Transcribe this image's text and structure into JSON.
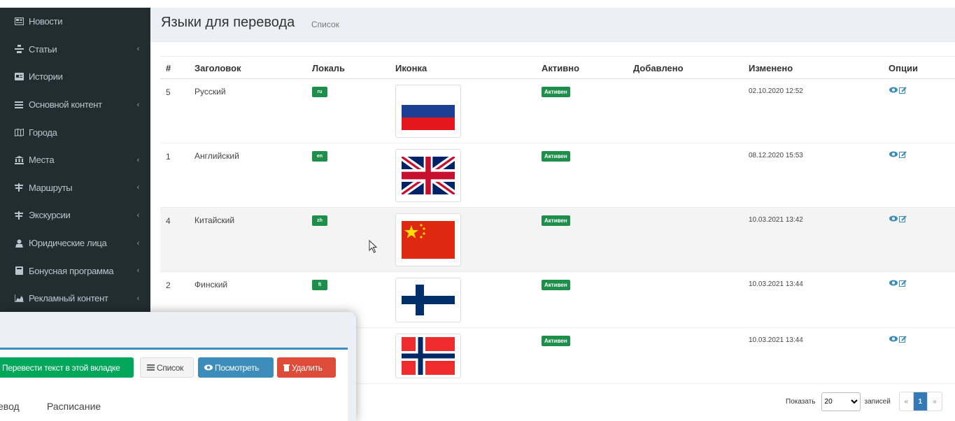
{
  "sidebar": {
    "items": [
      {
        "label": "Новости",
        "icon": "newspaper-icon",
        "has_chevron": false
      },
      {
        "label": "Статьи",
        "icon": "articles-icon",
        "has_chevron": true
      },
      {
        "label": "Истории",
        "icon": "id-card-icon",
        "has_chevron": false
      },
      {
        "label": "Основной контент",
        "icon": "bars-icon",
        "has_chevron": true
      },
      {
        "label": "Города",
        "icon": "map-icon",
        "has_chevron": false
      },
      {
        "label": "Места",
        "icon": "bank-icon",
        "has_chevron": true
      },
      {
        "label": "Маршруты",
        "icon": "signpost-icon",
        "has_chevron": true
      },
      {
        "label": "Экскурсии",
        "icon": "signpost-icon",
        "has_chevron": true
      },
      {
        "label": "Юридические лица",
        "icon": "user-secret-icon",
        "has_chevron": true
      },
      {
        "label": "Бонусная программа",
        "icon": "calculator-icon",
        "has_chevron": true
      },
      {
        "label": "Рекламный контент",
        "icon": "area-chart-icon",
        "has_chevron": true
      }
    ],
    "chevron": "‹"
  },
  "header": {
    "title": "Языки для перевода",
    "subtitle": "Список"
  },
  "table": {
    "columns": [
      "#",
      "Заголовок",
      "Локаль",
      "Иконка",
      "Активно",
      "Добавлено",
      "Изменено",
      "Опции"
    ],
    "rows": [
      {
        "id": "5",
        "title": "Русский",
        "locale": "ru",
        "flag": "russia-flag",
        "active": "Активен",
        "added": "",
        "modified": "02.10.2020 12:52"
      },
      {
        "id": "1",
        "title": "Английский",
        "locale": "en",
        "flag": "uk-flag",
        "active": "Активен",
        "added": "",
        "modified": "08.12.2020 15:53"
      },
      {
        "id": "4",
        "title": "Китайский",
        "locale": "zh",
        "flag": "china-flag",
        "active": "Активен",
        "added": "",
        "modified": "10.03.2021 13:42"
      },
      {
        "id": "2",
        "title": "Финский",
        "locale": "fi",
        "flag": "finland-flag",
        "active": "Активен",
        "added": "",
        "modified": "10.03.2021 13:44"
      },
      {
        "id": "",
        "title": "",
        "locale": "",
        "flag": "norway-flag",
        "active": "Активен",
        "added": "",
        "modified": "10.03.2021 13:44"
      }
    ]
  },
  "pagination": {
    "show_label": "Показать",
    "page_size": "20",
    "records_label": "записей",
    "prev": "«",
    "current": "1",
    "next": "»"
  },
  "overlay": {
    "buttons": {
      "translate": "Перевести текст в этой вкладке",
      "list": "Список",
      "view": "Посмотреть",
      "delete": "Удалить"
    },
    "tabs": [
      "евод",
      "Расписание"
    ]
  },
  "colors": {
    "sidebar_bg": "#222d32",
    "badge_green": "#1e8e4b",
    "primary": "#3c8dbc",
    "danger": "#dd4b39",
    "success": "#00a65a"
  }
}
